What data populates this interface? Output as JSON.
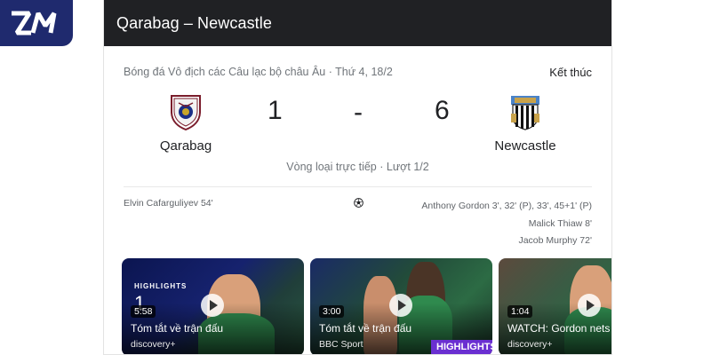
{
  "header": {
    "title": "Qarabag – Newcastle"
  },
  "match": {
    "competition_date": "Bóng đá Vô địch các Câu lạc bộ châu Âu · Thứ 4, 18/2",
    "status": "Kết thúc",
    "home": {
      "name": "Qarabag",
      "score": "1"
    },
    "away": {
      "name": "Newcastle",
      "score": "6"
    },
    "separator": "-",
    "round": "Vòng loại trực tiếp · Lượt 1/2"
  },
  "scorers": {
    "home": "Elvin Cafarguliyev 54'",
    "away": [
      "Anthony Gordon 3', 32' (P), 33', 45+1' (P)",
      "Malick Thiaw 8'",
      "Jacob Murphy 72'"
    ]
  },
  "videos": [
    {
      "duration": "5:58",
      "title": "Tóm tắt về trận đấu",
      "source": "discovery+",
      "badge": "HIGHLIGHTS"
    },
    {
      "duration": "3:00",
      "title": "Tóm tắt về trận đấu",
      "source": "BBC Sport",
      "badge": "HIGHLIGHTS"
    },
    {
      "duration": "1:04",
      "title": "WATCH: Gordon nets",
      "source": "discovery+"
    }
  ],
  "colors": {
    "header_bg": "#202124",
    "logo_bg": "#1f2a6e",
    "accent_purple": "#6a2fd1"
  },
  "icons": {
    "logo": "zm-logo",
    "ball": "football-icon",
    "play": "play-icon"
  }
}
